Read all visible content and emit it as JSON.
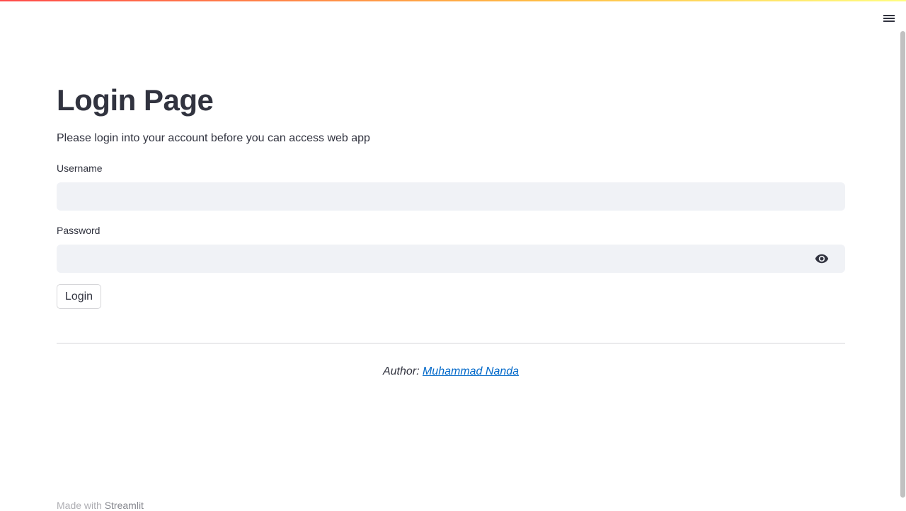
{
  "app": {
    "menu_icon": "hamburger-menu-icon",
    "colors": {
      "text": "#31333f",
      "input_bg": "#f0f2f6",
      "link": "#0068c9",
      "decoration_start": "#ff4b4b",
      "decoration_end": "#fffd80"
    }
  },
  "main": {
    "title": "Login Page",
    "subtitle": "Please login into your account before you can access web app"
  },
  "form": {
    "username": {
      "label": "Username",
      "value": "",
      "placeholder": ""
    },
    "password": {
      "label": "Password",
      "value": "",
      "placeholder": "",
      "toggle_icon": "eye-icon"
    },
    "submit_label": "Login"
  },
  "author": {
    "prefix": "Author: ",
    "name": "Muhammad Nanda"
  },
  "footer": {
    "made_with": "Made with ",
    "brand": "Streamlit"
  }
}
